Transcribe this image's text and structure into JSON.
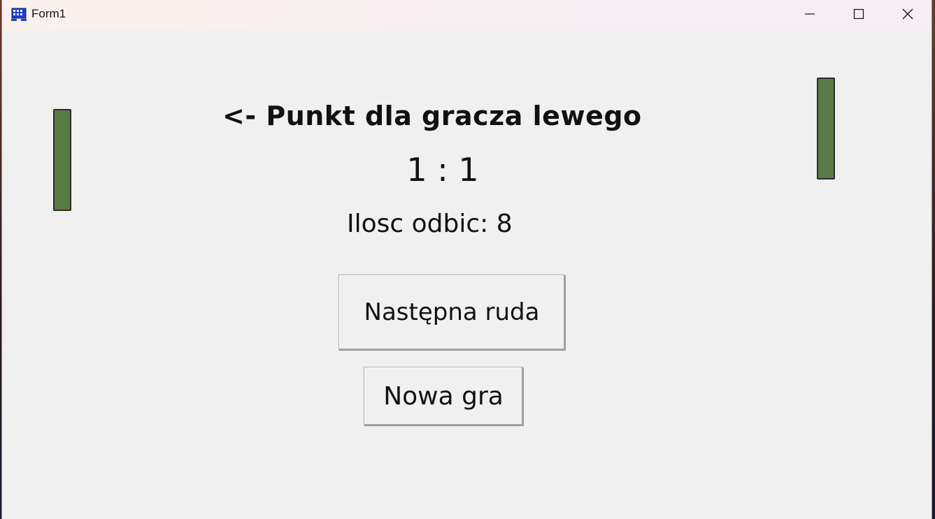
{
  "window": {
    "title": "Form1",
    "app_icon": "winforms-app-icon",
    "controls": {
      "minimize_icon": "minimize-icon",
      "maximize_icon": "maximize-icon",
      "close_icon": "close-icon"
    }
  },
  "game": {
    "message": "<- Punkt dla gracza lewego",
    "score": "1 : 1",
    "bounces_label": "Ilosc odbic: 8",
    "paddle_color": "#5a7b45"
  },
  "buttons": {
    "next_round_label": "Następna ruda",
    "new_game_label": "Nowa gra"
  }
}
